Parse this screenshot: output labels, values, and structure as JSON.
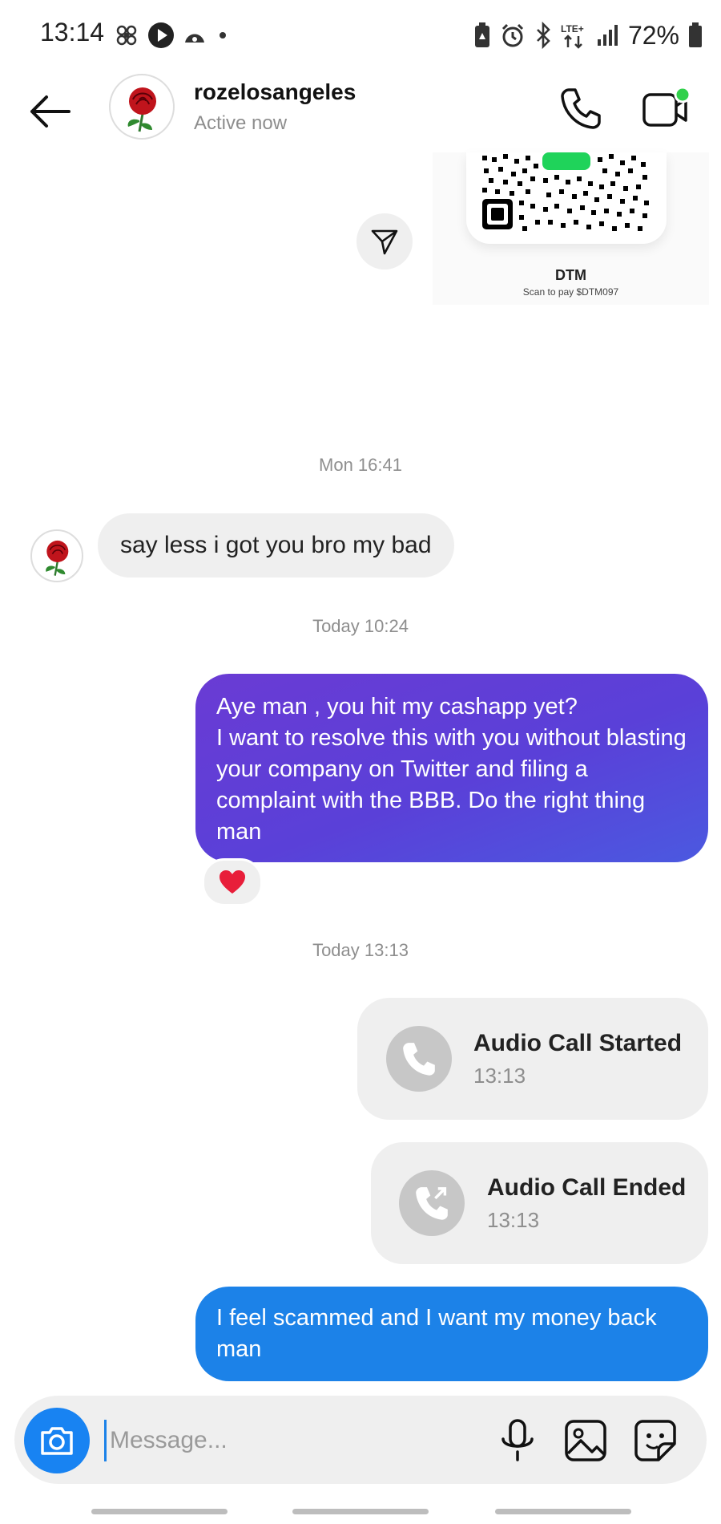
{
  "status_bar": {
    "time": "13:14",
    "battery": "72%",
    "network": "LTE+",
    "icons_left": [
      "fan-icon",
      "play-icon",
      "app-icon",
      "dot-icon"
    ],
    "icons_right": [
      "battery-saver-icon",
      "alarm-icon",
      "bluetooth-icon",
      "lte-icon",
      "signal-icon",
      "battery-icon"
    ]
  },
  "header": {
    "name": "rozelosangeles",
    "status": "Active now",
    "online_color": "#31d04b"
  },
  "shared_card": {
    "title": "DTM",
    "subtitle": "Scan to pay $DTM097"
  },
  "thread": {
    "ts1": "Mon 16:41",
    "incoming_1": "say less i got you bro my bad",
    "ts2": "Today 10:24",
    "outgoing_1": "Aye man , you hit my cashapp yet?\nI want to resolve this with you without blasting your company on Twitter and filing a complaint with the BBB. Do the right thing man",
    "reaction": "❤️",
    "ts3": "Today 13:13",
    "call_started": {
      "title": "Audio Call Started",
      "time": "13:13"
    },
    "call_ended": {
      "title": "Audio Call Ended",
      "time": "13:13"
    },
    "outgoing_2": "I feel scammed and I want my money back man"
  },
  "composer": {
    "placeholder": "Message...",
    "value": ""
  },
  "colors": {
    "purple_bubble": "#5a40d8",
    "blue_bubble": "#1c82e8",
    "camera_button": "#1883f2"
  }
}
